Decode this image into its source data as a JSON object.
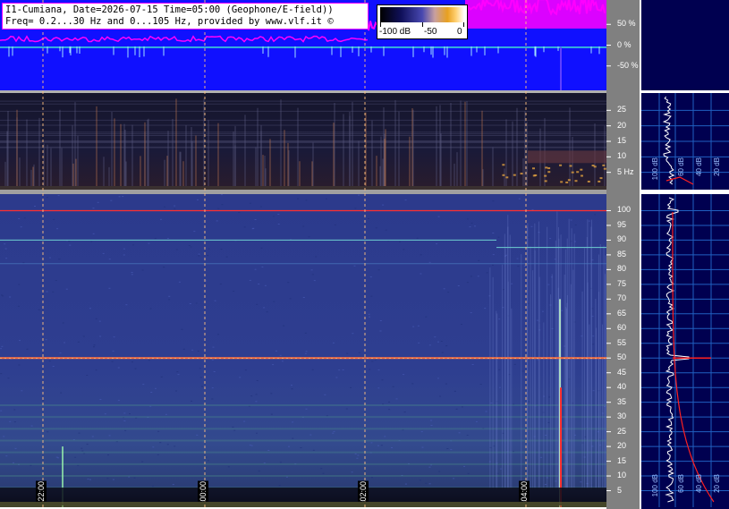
{
  "header": {
    "line1": "I1-Cumiana, Date=2026-07-15 Time=05:00 (Geophone/E-field))",
    "line2": "Freq= 0.2...30 Hz and 0...105 Hz, provided by www.vlf.it ©"
  },
  "colorbar": {
    "labels": [
      "-100 dB",
      "-50",
      "0"
    ]
  },
  "chart_data": [
    {
      "type": "line",
      "panel": "amplitude-strip",
      "y_ticks": [
        "50 %",
        "0 %",
        "-50 %"
      ],
      "ylim": [
        -100,
        100
      ],
      "colors": {
        "background": "#1010ff",
        "signal": "#ff00ff",
        "trace": "#40e0d0"
      }
    },
    {
      "type": "heatmap",
      "panel": "spectrogram-low",
      "y_ticks": [
        "25",
        "20",
        "15",
        "10",
        "5 Hz"
      ],
      "y_values": [
        25,
        20,
        15,
        10,
        5
      ],
      "ylim": [
        0,
        30
      ]
    },
    {
      "type": "heatmap",
      "panel": "spectrogram-high",
      "y_ticks": [
        "100",
        "95",
        "90",
        "85",
        "80",
        "75",
        "70",
        "65",
        "60",
        "55",
        "50",
        "45",
        "40",
        "35",
        "30",
        "25",
        "20",
        "15",
        "10",
        "5"
      ],
      "y_values": [
        100,
        95,
        90,
        85,
        80,
        75,
        70,
        65,
        60,
        55,
        50,
        45,
        40,
        35,
        30,
        25,
        20,
        15,
        10,
        5
      ],
      "ylim": [
        0,
        105
      ],
      "x_ticks": [
        "22:00",
        "00:00",
        "02:00",
        "04:00"
      ],
      "lines_hz": [
        100,
        50,
        90
      ]
    },
    {
      "type": "line",
      "panel": "spectrum-side",
      "low_labels": [
        "100 dB",
        "60 dB",
        "40 dB",
        "20 dB"
      ],
      "high_labels": [
        "100 dB",
        "60 dB",
        "40 dB",
        "20 dB"
      ]
    }
  ]
}
